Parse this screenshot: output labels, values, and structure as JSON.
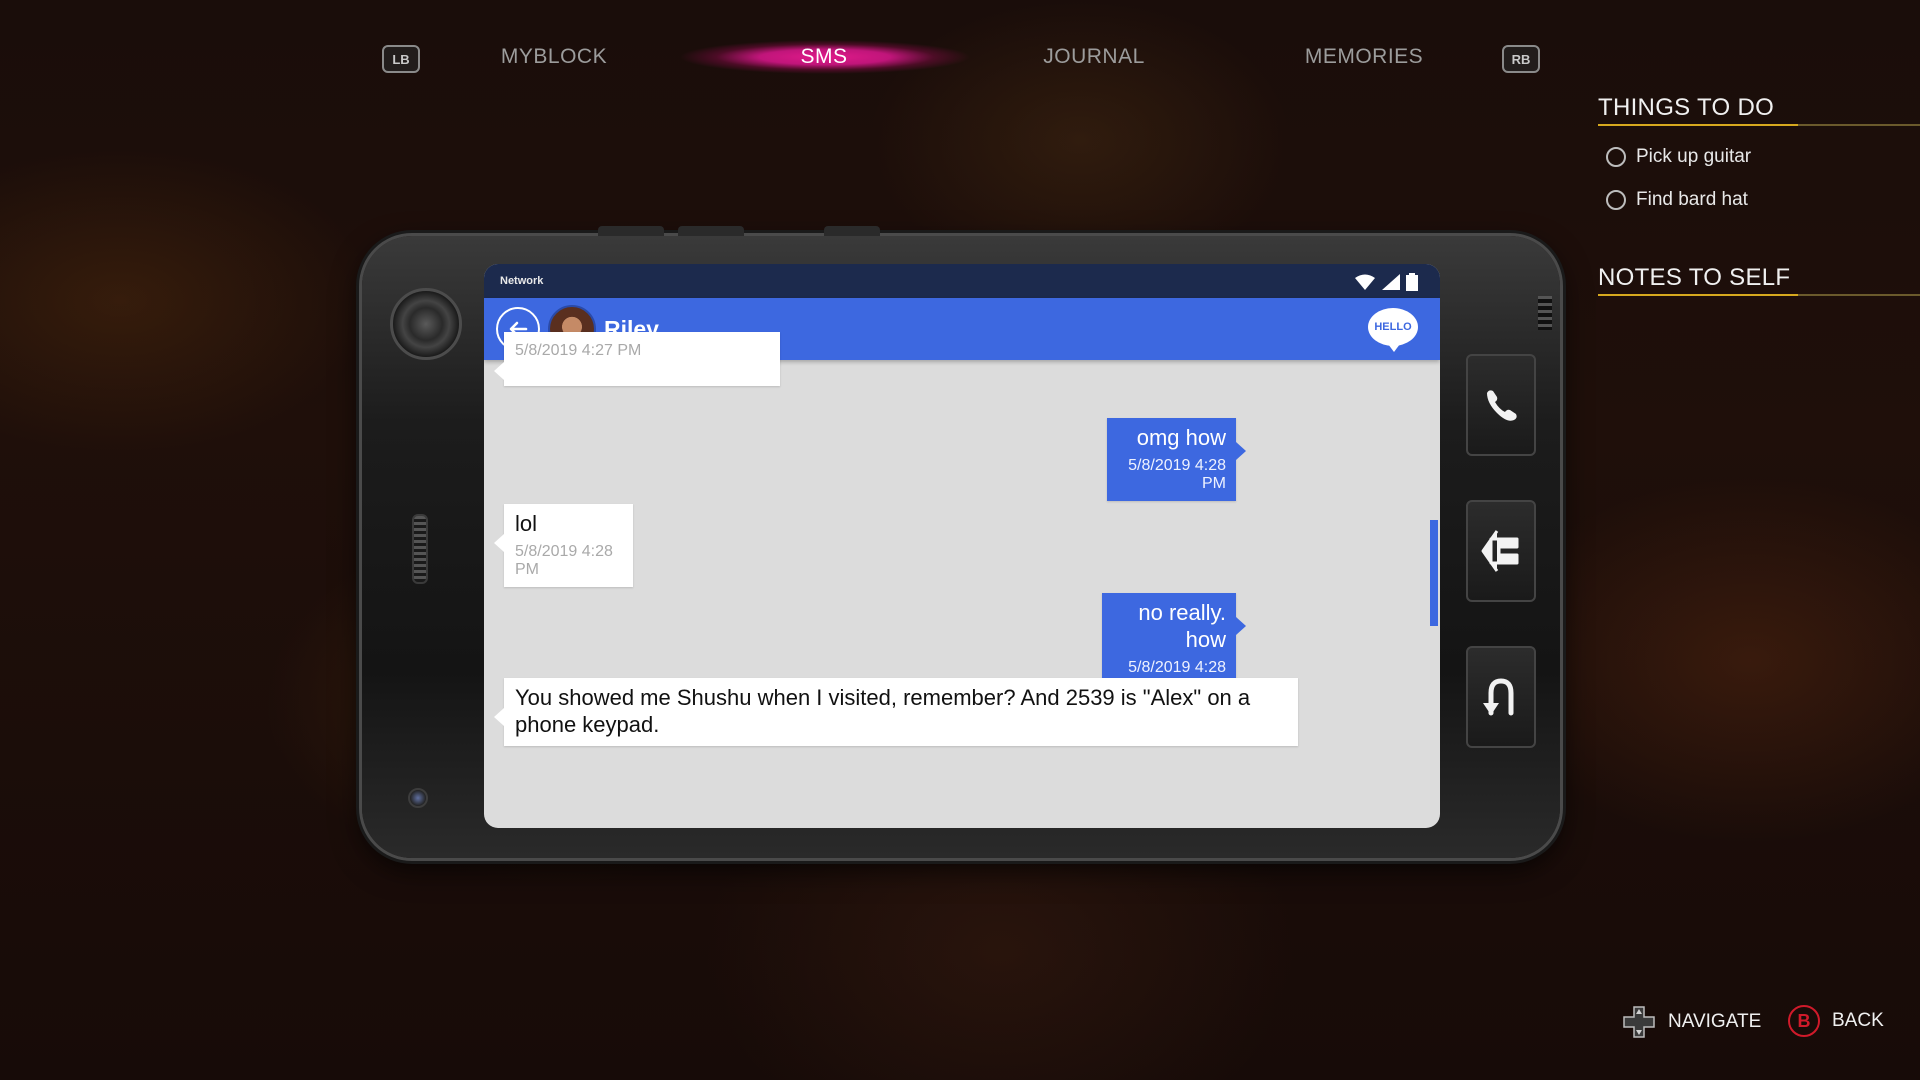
{
  "nav": {
    "left_bumper": "LB",
    "right_bumper": "RB",
    "tabs": [
      {
        "label": "MYBLOCK",
        "active": false
      },
      {
        "label": "SMS",
        "active": true
      },
      {
        "label": "JOURNAL",
        "active": false
      },
      {
        "label": "MEMORIES",
        "active": false
      }
    ],
    "active_glow_color": "#e01a8a"
  },
  "side_panel": {
    "todo_title": "THINGS TO DO",
    "todo_items": [
      "Pick up guitar",
      "Find bard hat"
    ],
    "notes_title": "NOTES TO SELF",
    "accent_color": "#d6a81e"
  },
  "phone": {
    "status": {
      "network_label": "Network"
    },
    "header": {
      "contact_name": "Riley",
      "badge_label": "HELLO",
      "color": "#3d68e0"
    },
    "messages": [
      {
        "from": "contact",
        "text": "",
        "time": "5/8/2019 4:27 PM"
      },
      {
        "from": "me",
        "text": "omg how",
        "time": "5/8/2019 4:28 PM"
      },
      {
        "from": "contact",
        "text": "lol",
        "time": "5/8/2019 4:28 PM"
      },
      {
        "from": "me",
        "text": "no really. how",
        "time": "5/8/2019 4:28 PM"
      },
      {
        "from": "contact",
        "text": "You showed me Shushu when I visited, remember? And 2539 is \"Alex\" on a phone keypad.",
        "time": ""
      }
    ],
    "side_buttons": [
      "phone-call-icon",
      "hang-up-icon",
      "u-turn-icon"
    ]
  },
  "hints": {
    "navigate_label": "NAVIGATE",
    "back_label": "BACK",
    "back_button": "B"
  }
}
